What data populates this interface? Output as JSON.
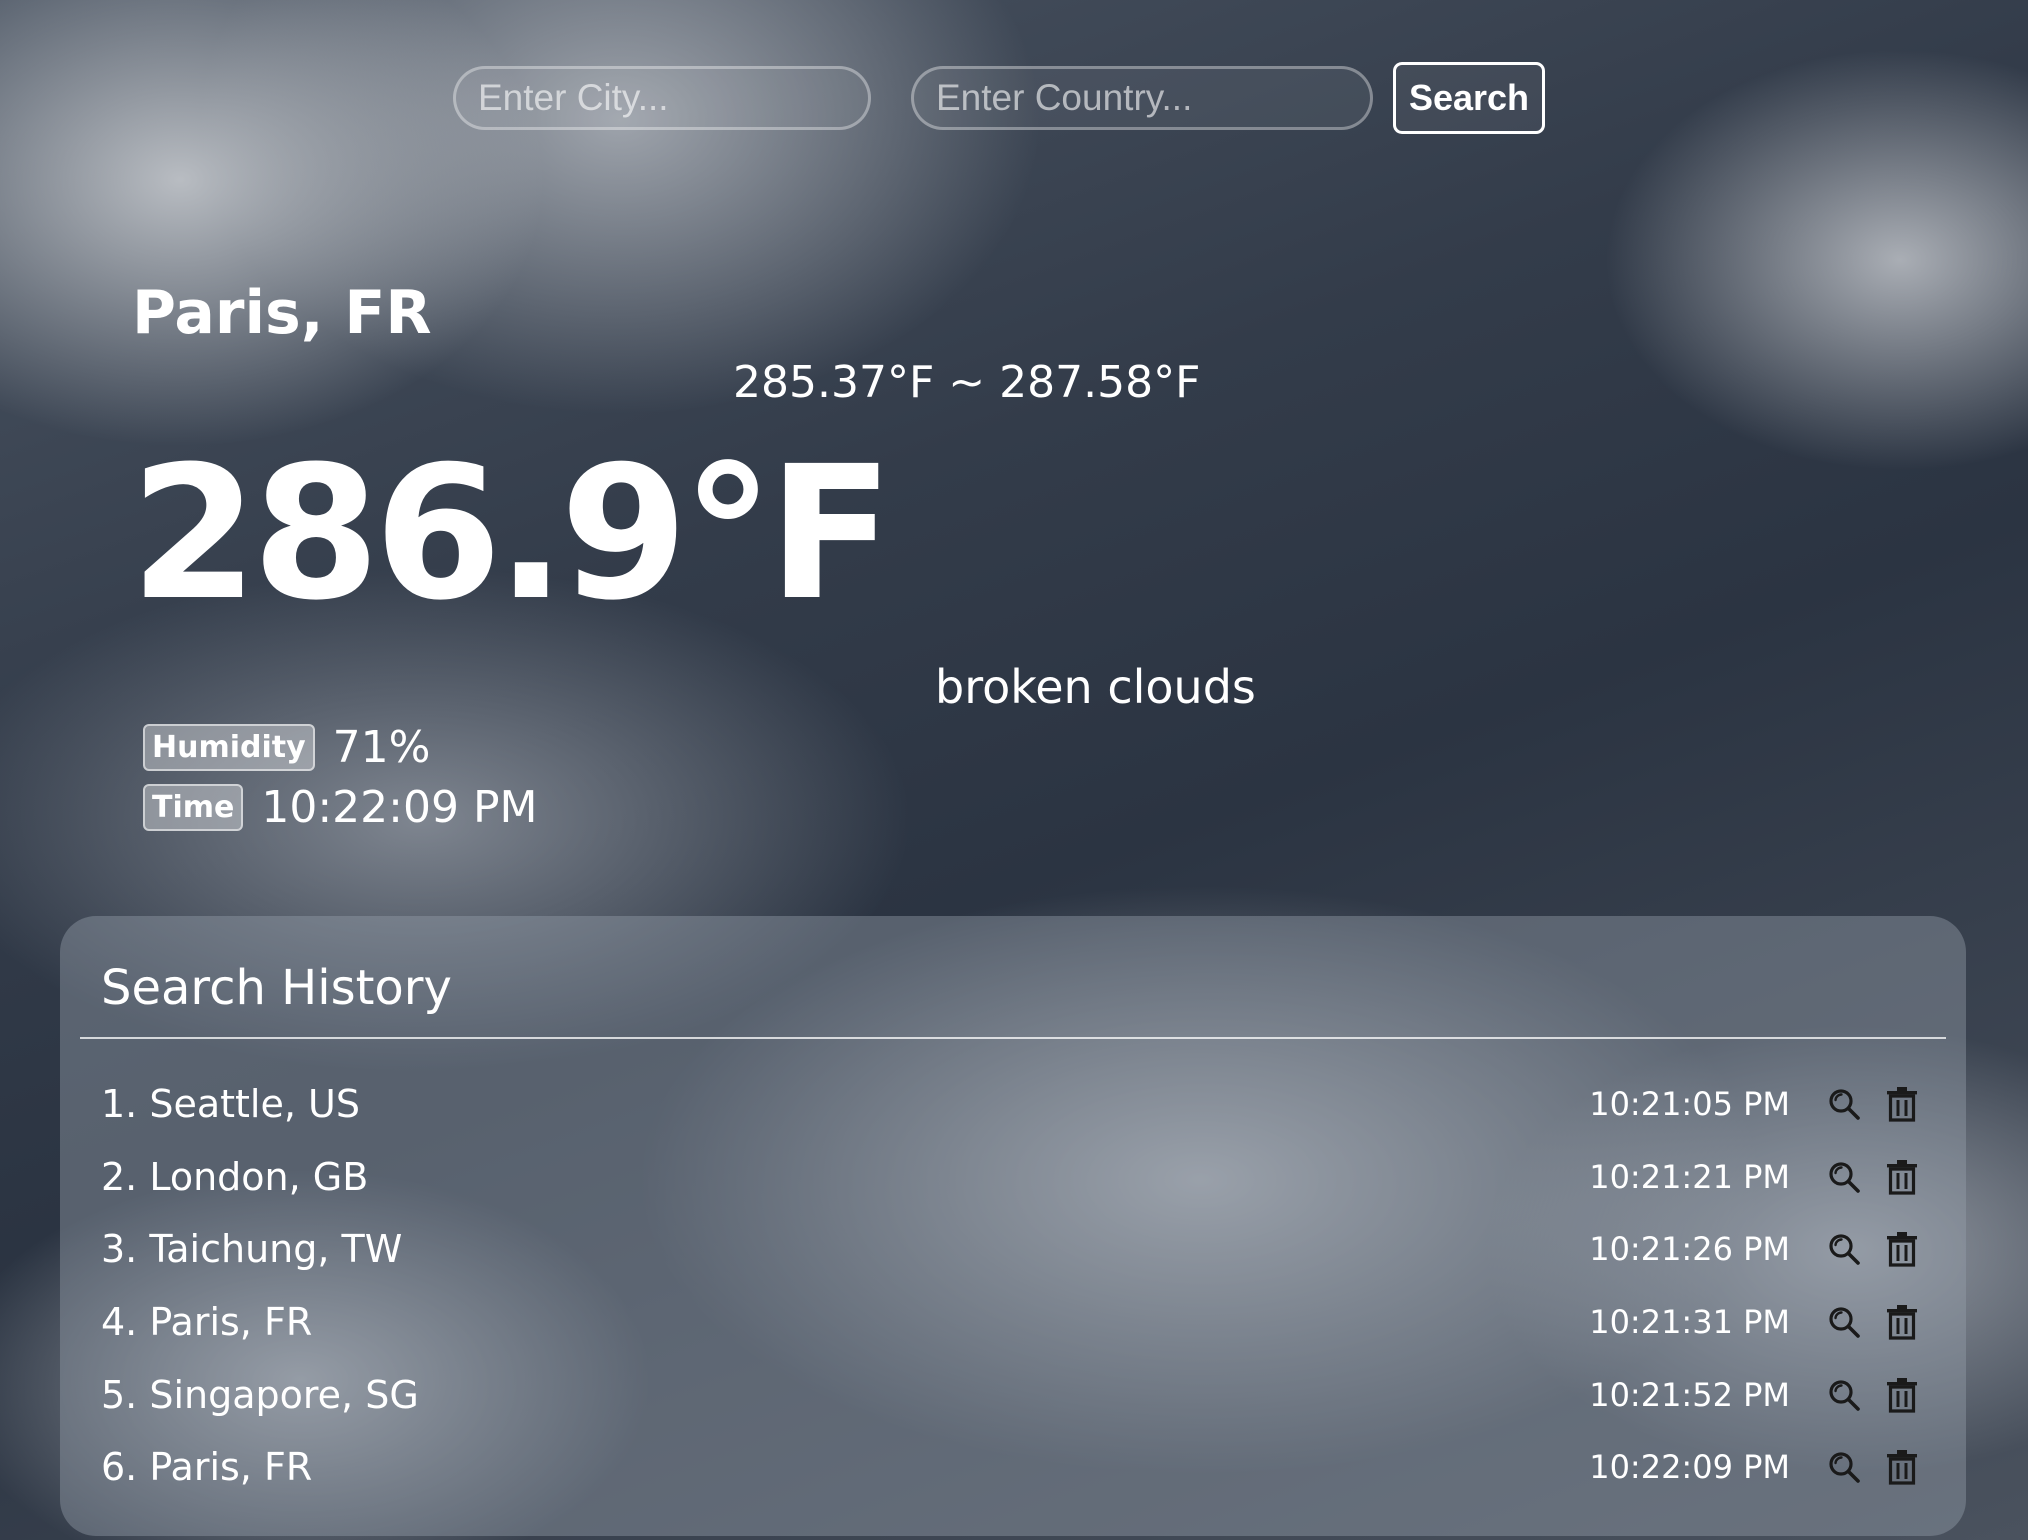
{
  "search": {
    "city_placeholder": "Enter City...",
    "country_placeholder": "Enter Country...",
    "button_label": "Search"
  },
  "current": {
    "location": "Paris, FR",
    "temp_range": "285.37°F ~ 287.58°F",
    "temperature": "286.9°F",
    "description": "broken clouds",
    "humidity_label": "Humidity",
    "humidity_value": "71%",
    "time_label": "Time",
    "time_value": "10:22:09 PM"
  },
  "history": {
    "title": "Search History",
    "items": [
      {
        "location": "1. Seattle, US",
        "time": "10:21:05 PM"
      },
      {
        "location": "2. London, GB",
        "time": "10:21:21 PM"
      },
      {
        "location": "3. Taichung, TW",
        "time": "10:21:26 PM"
      },
      {
        "location": "4. Paris, FR",
        "time": "10:21:31 PM"
      },
      {
        "location": "5. Singapore, SG",
        "time": "10:21:52 PM"
      },
      {
        "location": "6. Paris, FR",
        "time": "10:22:09 PM"
      }
    ],
    "search_icon": "magnifier-icon",
    "delete_icon": "trash-icon"
  },
  "colors": {
    "text": "#ffffff",
    "icon": "#1a1a1a",
    "panel": "#96a0ac"
  }
}
